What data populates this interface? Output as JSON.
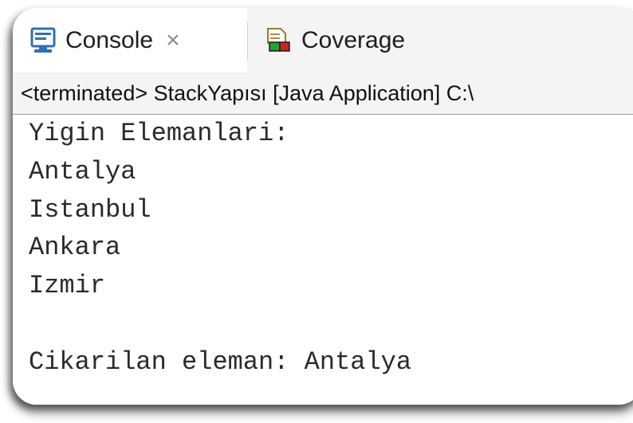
{
  "tabs": [
    {
      "label": "Console",
      "icon": "console-icon",
      "active": true,
      "closable": true
    },
    {
      "label": "Coverage",
      "icon": "coverage-icon",
      "active": false,
      "closable": false
    }
  ],
  "status": {
    "text": "<terminated> StackYapısı [Java Application] C:\\"
  },
  "console_output": {
    "lines": [
      "Yigin Elemanlari:",
      "Antalya",
      "Istanbul",
      "Ankara",
      "Izmir",
      "",
      "Cikarilan eleman: Antalya"
    ]
  },
  "colors": {
    "tab_bar_bg": "#f4f4f4",
    "console_icon_blue": "#2f6fb3",
    "coverage_green": "#1aa52b",
    "coverage_red": "#d6201c"
  }
}
